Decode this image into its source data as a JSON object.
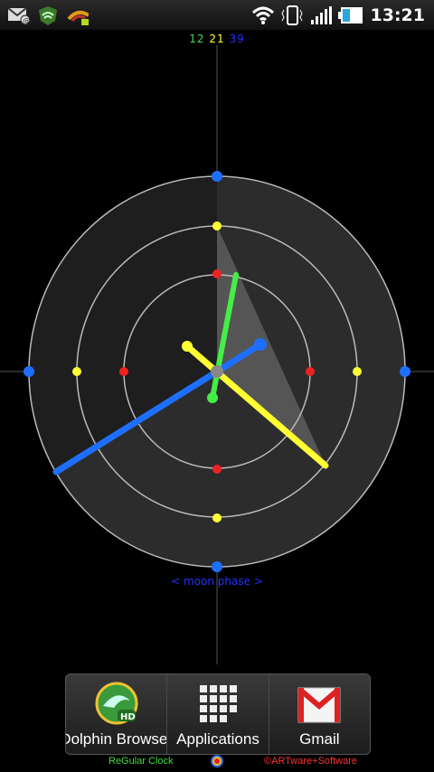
{
  "statusbar": {
    "time": "13:21",
    "left_icons": [
      "mail-at-icon",
      "shield-wifi-icon",
      "rss-icon"
    ],
    "right_icons": [
      "wifi-icon",
      "vibrate-icon",
      "signal-icon",
      "battery-icon"
    ]
  },
  "clock": {
    "hour": "12",
    "minute": "21",
    "second": "39",
    "colors": {
      "hour": "#44dd44",
      "minute": "#ffff33",
      "second": "#1e6fff",
      "ring": "#bbbbbb",
      "marker_red": "#ee2222"
    }
  },
  "moon_label": "< moon phase >",
  "dock": {
    "items": [
      {
        "label": "Dolphin Browser",
        "icon": "dolphin-browser-icon"
      },
      {
        "label": "Applications",
        "icon": "apps-grid-icon"
      },
      {
        "label": "Gmail",
        "icon": "gmail-icon"
      }
    ]
  },
  "footer": {
    "left": "ReGular Clock",
    "right": "©ARTware+Software"
  }
}
